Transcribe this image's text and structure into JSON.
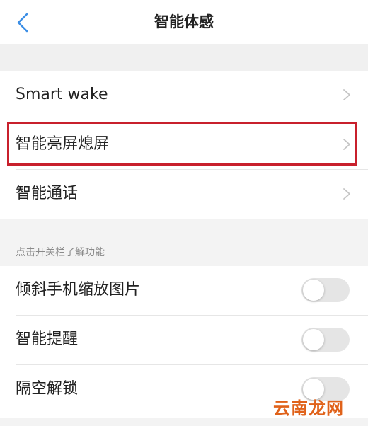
{
  "header": {
    "title": "智能体感",
    "back_icon": "back-arrow-icon"
  },
  "group1": {
    "items": [
      {
        "label": "Smart wake",
        "icon": "chevron-right-icon"
      },
      {
        "label": "智能亮屏熄屏",
        "icon": "chevron-right-icon",
        "highlighted": true
      },
      {
        "label": "智能通话",
        "icon": "chevron-right-icon"
      }
    ]
  },
  "group2": {
    "section_label": "点击开关栏了解功能",
    "items": [
      {
        "label": "倾斜手机缩放图片",
        "toggle_on": false
      },
      {
        "label": "智能提醒",
        "toggle_on": false
      },
      {
        "label": "隔空解锁",
        "toggle_on": false
      }
    ]
  },
  "watermark": {
    "text": "云南龙网"
  },
  "colors": {
    "accent_back_arrow": "#3b8ee6",
    "highlight_border": "#c8202c",
    "toggle_off": "#e5e5e5",
    "watermark": "#e0621a"
  }
}
